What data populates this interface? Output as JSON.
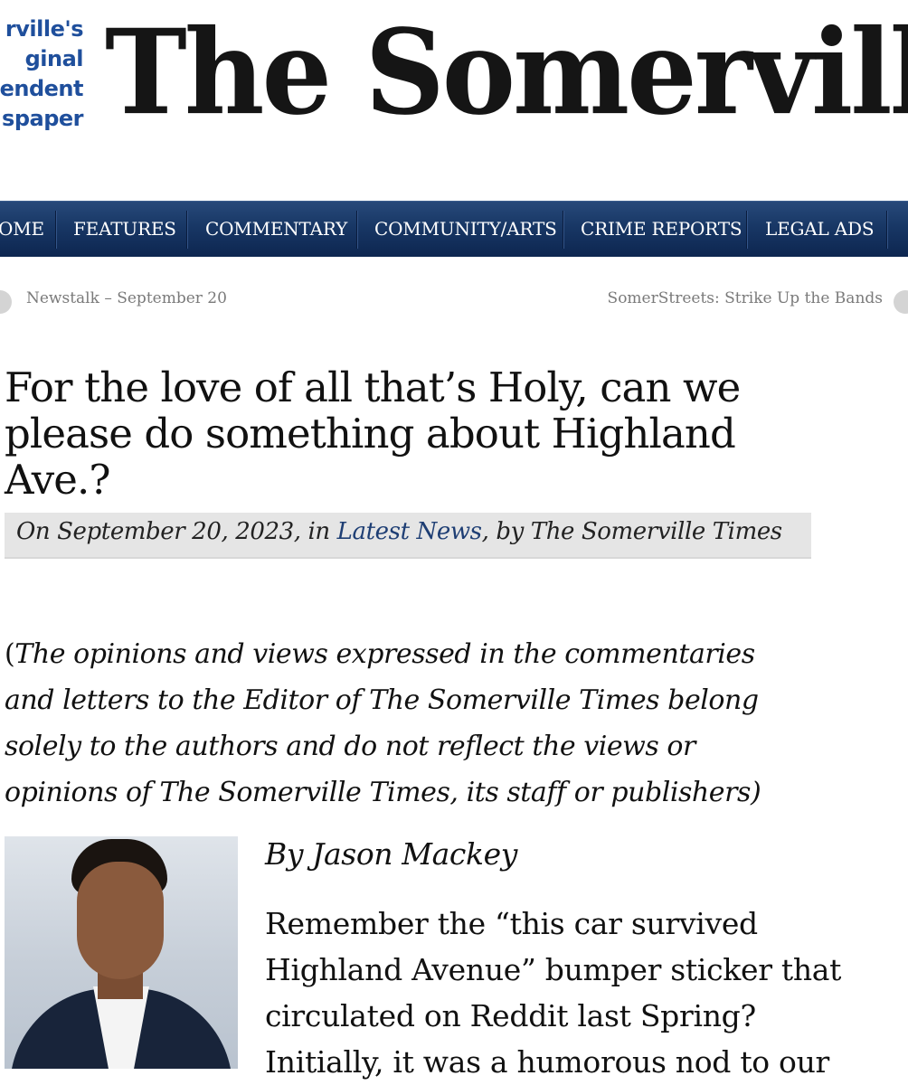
{
  "masthead": {
    "tagline_lines": [
      "rville's",
      "ginal",
      "endent",
      "spaper"
    ],
    "logo_text": "The Somerville",
    "brand_color": "#1f4f9c"
  },
  "nav": {
    "items": [
      "OME",
      "FEATURES",
      "COMMENTARY",
      "COMMUNITY/ARTS",
      "CRIME REPORTS",
      "LEGAL ADS"
    ],
    "bar_color": "#183765"
  },
  "post_nav": {
    "prev_label": "Newstalk – September 20",
    "next_label": "SomerStreets: Strike Up the Bands",
    "prev_icon": "arrow-left-icon",
    "next_icon": "arrow-right-icon"
  },
  "article": {
    "title_lines": [
      "For the love of all that’s Holy, can we",
      "please do something about Highland",
      "Ave.?"
    ],
    "meta": {
      "prefix": "On September 20, 2023, in ",
      "category": "Latest News",
      "suffix": ", by The Somerville Times"
    },
    "disclaimer_lines": [
      {
        "lead": "(",
        "text": "The opinions and views expressed in the commentaries"
      },
      {
        "lead": "",
        "text": "and letters to the Editor of The Somerville Times belong"
      },
      {
        "lead": "",
        "text": "solely to the authors and do not reflect the views or"
      },
      {
        "lead": "",
        "text": "opinions of The Somerville Times, its staff or publishers)"
      }
    ],
    "author_credit": "By Jason Mackey",
    "body_lines": [
      "Remember the “this car survived",
      "Highland Avenue” bumper sticker that",
      "circulated on Reddit last Spring?",
      "Initially, it was a humorous nod to our"
    ]
  }
}
